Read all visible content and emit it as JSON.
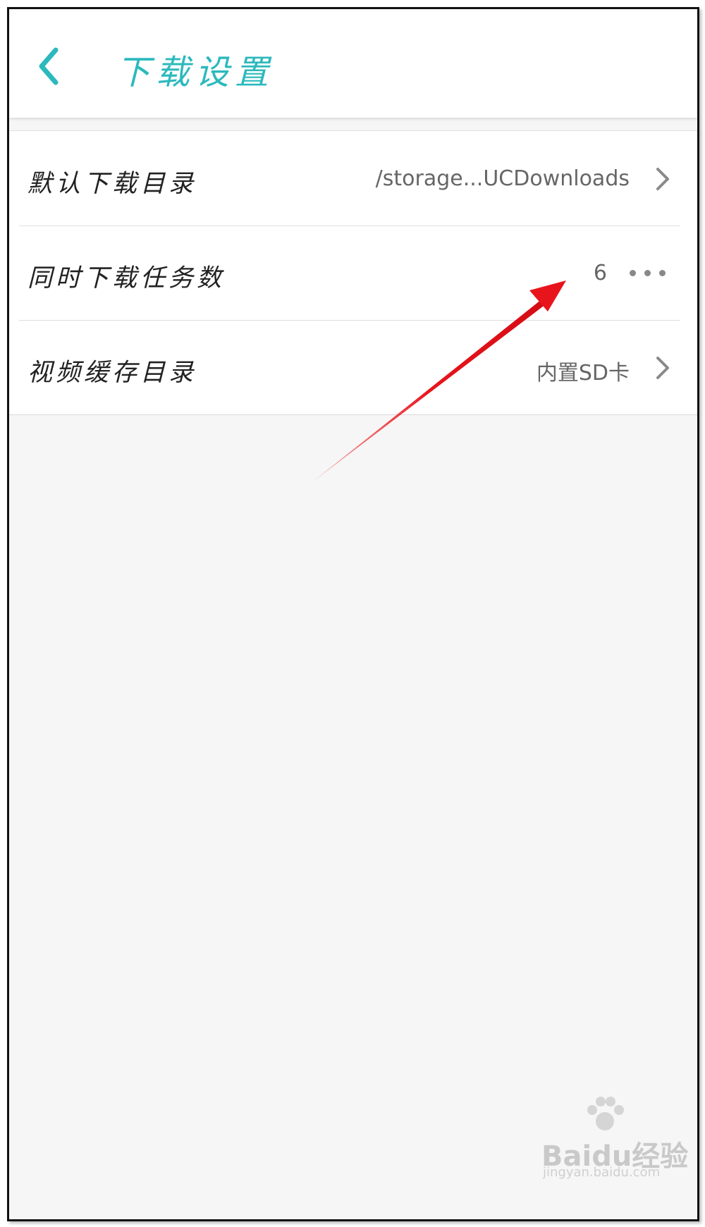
{
  "header": {
    "title": "下载设置",
    "back_icon": "chevron-left-icon",
    "accent_color": "#2bb9bd"
  },
  "settings": [
    {
      "label": "默认下载目录",
      "value": "/storage...UCDownloads",
      "control": "chevron-right-icon"
    },
    {
      "label": "同时下载任务数",
      "value": "6",
      "control": "more-dots-icon"
    },
    {
      "label": "视频缓存目录",
      "value": "内置SD卡",
      "control": "chevron-right-icon"
    }
  ],
  "annotation": {
    "arrow_color": "#e8141c"
  },
  "watermark": {
    "text": "Baidu经验",
    "url": "jingyan.baidu.com"
  }
}
